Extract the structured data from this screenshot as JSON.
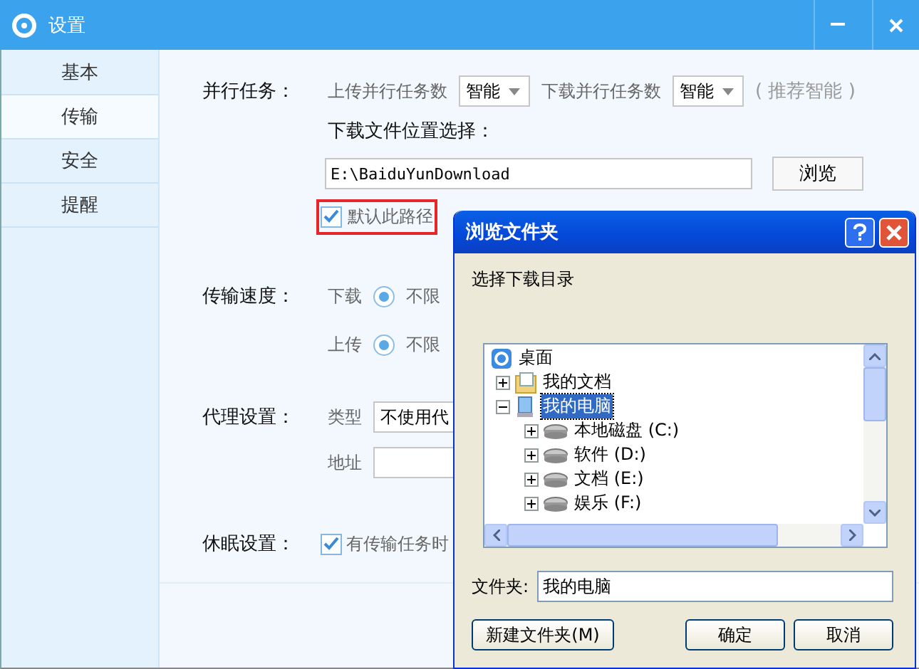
{
  "window": {
    "title": "设置"
  },
  "sidebar": {
    "items": [
      {
        "label": "基本",
        "selected": false
      },
      {
        "label": "传输",
        "selected": true
      },
      {
        "label": "安全",
        "selected": false
      },
      {
        "label": "提醒",
        "selected": false
      }
    ]
  },
  "parallel": {
    "label": "并行任务：",
    "upload_label": "上传并行任务数",
    "upload_value": "智能",
    "download_label": "下载并行任务数",
    "download_value": "智能",
    "hint": "( 推荐智能 )"
  },
  "location": {
    "label": "下载文件位置选择：",
    "path": "E:\\BaiduYunDownload",
    "browse_button": "浏览",
    "default_checkbox": {
      "label": "默认此路径",
      "checked": true,
      "highlighted": true
    }
  },
  "speed": {
    "label": "传输速度：",
    "rows": [
      {
        "label": "下载",
        "option": "不限",
        "selected": true
      },
      {
        "label": "上传",
        "option": "不限",
        "selected": true
      }
    ]
  },
  "proxy": {
    "label": "代理设置：",
    "type_label": "类型",
    "type_value": "不使用代",
    "address_label": "地址"
  },
  "sleep": {
    "label": "休眠设置：",
    "checkbox": {
      "label": "有传输任务时",
      "checked": true
    }
  },
  "dialog": {
    "title": "浏览文件夹",
    "prompt": "选择下载目录",
    "tree": [
      {
        "kind": "desktop",
        "label": "桌面",
        "selected": false,
        "children": [
          {
            "kind": "documents",
            "label": "我的文档",
            "expanded": false,
            "selected": false
          },
          {
            "kind": "computer",
            "label": "我的电脑",
            "expanded": true,
            "selected": true,
            "children": [
              {
                "kind": "drive",
                "label": "本地磁盘 (C:)",
                "expanded": false,
                "selected": false
              },
              {
                "kind": "drive",
                "label": "软件 (D:)",
                "expanded": false,
                "selected": false
              },
              {
                "kind": "drive",
                "label": "文档 (E:)",
                "expanded": false,
                "selected": false
              },
              {
                "kind": "drive",
                "label": "娱乐 (F:)",
                "expanded": false,
                "selected": false
              }
            ]
          }
        ]
      }
    ],
    "folder_label": "文件夹:",
    "folder_value": "我的电脑",
    "buttons": [
      {
        "label": "新建文件夹(M)",
        "kind": "left"
      },
      {
        "label": "确定",
        "kind": "right"
      },
      {
        "label": "取消",
        "kind": "right"
      }
    ]
  }
}
